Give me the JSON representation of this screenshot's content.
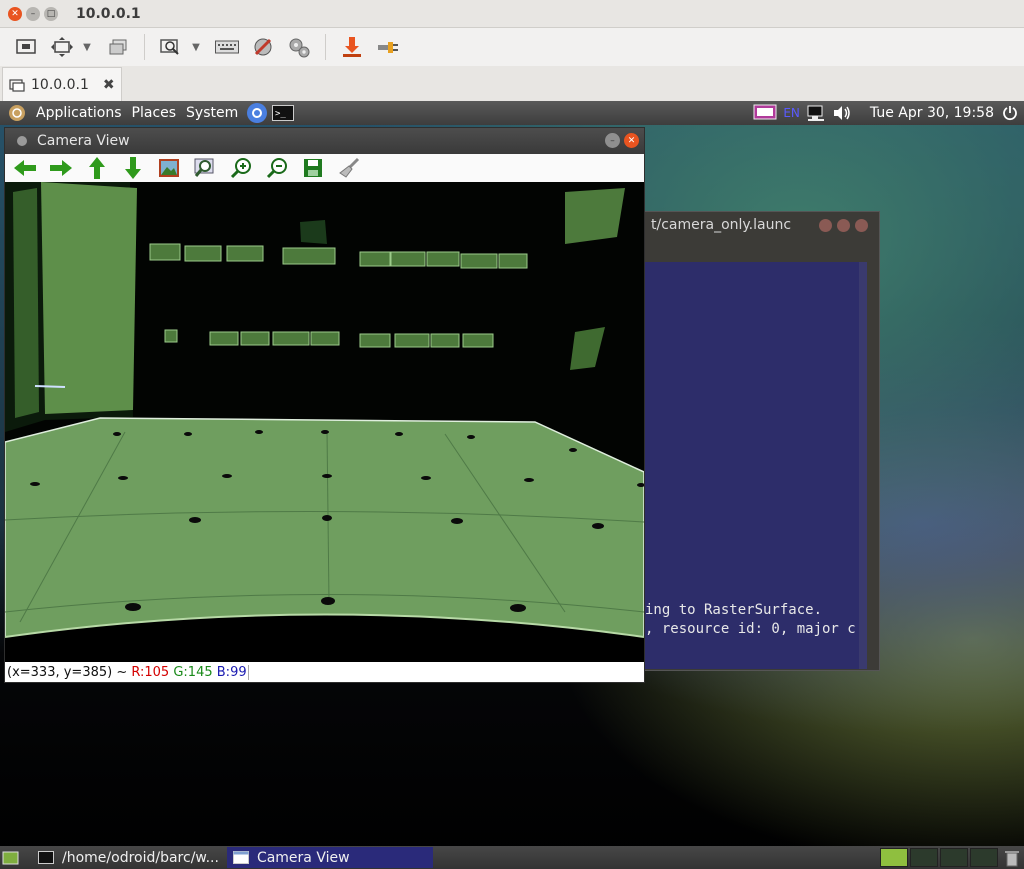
{
  "vnc": {
    "title": "10.0.0.1",
    "tab_label": "10.0.0.1",
    "tab_close": "✖",
    "toolbar_icons": [
      "remote-desktop-icon",
      "fit-window-icon",
      "view-options-icon",
      "zoom-icon",
      "keyboard-icon",
      "preferences-icon",
      "settings-gears-icon",
      "transfer-icon",
      "disconnect-icon"
    ]
  },
  "top_panel": {
    "menus": [
      "Applications",
      "Places",
      "System"
    ],
    "keyboard_layout": "EN",
    "clock": "Tue Apr 30, 19:58"
  },
  "terminal": {
    "title": "t/camera_only.launc",
    "lines": [
      "ing to RasterSurface.",
      ", resource id: 0, major c"
    ]
  },
  "camera_view": {
    "title": "Camera View",
    "status": {
      "coords": "(x=333, y=385) ~",
      "r": "R:105",
      "g": "G:145",
      "b": "B:99"
    }
  },
  "taskbar": {
    "items": [
      "/home/odroid/barc/w...",
      "Camera View"
    ]
  },
  "colors": {
    "accent_close": "#e95420",
    "floor": "#6f9e5f",
    "arrow_green": "#2f9a1c"
  }
}
